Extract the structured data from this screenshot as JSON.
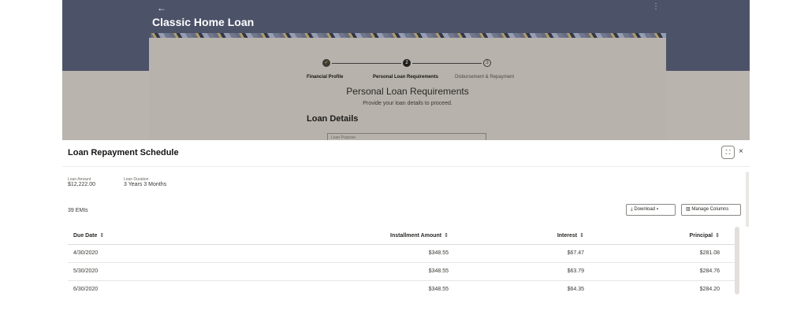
{
  "background": {
    "back_icon": "←",
    "page_title": "Classic Home Loan",
    "stepper": {
      "steps": [
        {
          "label": "Financial Profile",
          "marker": "✓",
          "state": "done"
        },
        {
          "label": "Personal Loan Requirements",
          "marker": "2",
          "state": "current"
        },
        {
          "label": "Disbursement & Repayment",
          "marker": "3",
          "state": "pending"
        }
      ]
    },
    "section_title": "Personal Loan Requirements",
    "section_subtitle": "Provide your loan details to proceed.",
    "loan_details_heading": "Loan Details",
    "loan_purpose_placeholder": "Loan Purpose"
  },
  "drawer": {
    "title": "Loan Repayment Schedule",
    "expand_icon": "⛶",
    "close_icon": "×",
    "summary": {
      "loan_amount_label": "Loan Amount",
      "loan_amount": "$12,222.00",
      "loan_duration_label": "Loan Duration",
      "loan_duration": "3 Years 3 Months"
    },
    "emi_count": "39 EMIs",
    "download_label": "Download",
    "manage_columns_label": "Manage Columns",
    "table": {
      "headers": {
        "due_date": "Due Date",
        "installment": "Installment Amount",
        "interest": "Interest",
        "principal": "Principal"
      },
      "rows": [
        {
          "due_date": "4/30/2020",
          "installment": "$348.55",
          "interest": "$67.47",
          "principal": "$281.08"
        },
        {
          "due_date": "5/30/2020",
          "installment": "$348.55",
          "interest": "$63.79",
          "principal": "$284.76"
        },
        {
          "due_date": "6/30/2020",
          "installment": "$348.55",
          "interest": "$64.35",
          "principal": "$284.20"
        }
      ]
    }
  },
  "colors": {
    "header_bg": "#4c5268",
    "overlay_bg": "#b9b4ae",
    "drawer_bg": "#ffffff"
  }
}
